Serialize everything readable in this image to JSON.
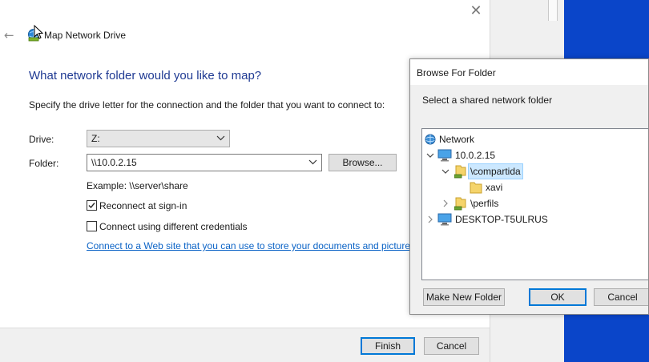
{
  "wizard": {
    "title": "Map Network Drive",
    "heading": "What network folder would you like to map?",
    "instructions": "Specify the drive letter for the connection and the folder that you want to connect to:",
    "drive_label": "Drive:",
    "drive_value": "Z:",
    "folder_label": "Folder:",
    "folder_value": "\\\\10.0.2.15",
    "browse_label": "Browse...",
    "example": "Example: \\\\server\\share",
    "reconnect_label": "Reconnect at sign-in",
    "reconnect_checked": true,
    "credentials_label": "Connect using different credentials",
    "credentials_checked": false,
    "link_text": "Connect to a Web site that you can use to store your documents and pictures.",
    "finish_label": "Finish",
    "cancel_label": "Cancel"
  },
  "browse_dialog": {
    "title": "Browse For Folder",
    "description": "Select a shared network folder",
    "tree": {
      "root": "Network",
      "host": "10.0.2.15",
      "share_selected": "\\compartida",
      "subfolder": "xavi",
      "share_other": "\\perfils",
      "desktop": "DESKTOP-T5ULRUS"
    },
    "make_folder_label": "Make New Folder",
    "ok_label": "OK",
    "cancel_label": "Cancel"
  },
  "colors": {
    "heading": "#1f3a93",
    "link": "#0b63c6",
    "selection": "#cce8ff",
    "accent": "#0078d7",
    "desktop": "#0a45c9"
  }
}
